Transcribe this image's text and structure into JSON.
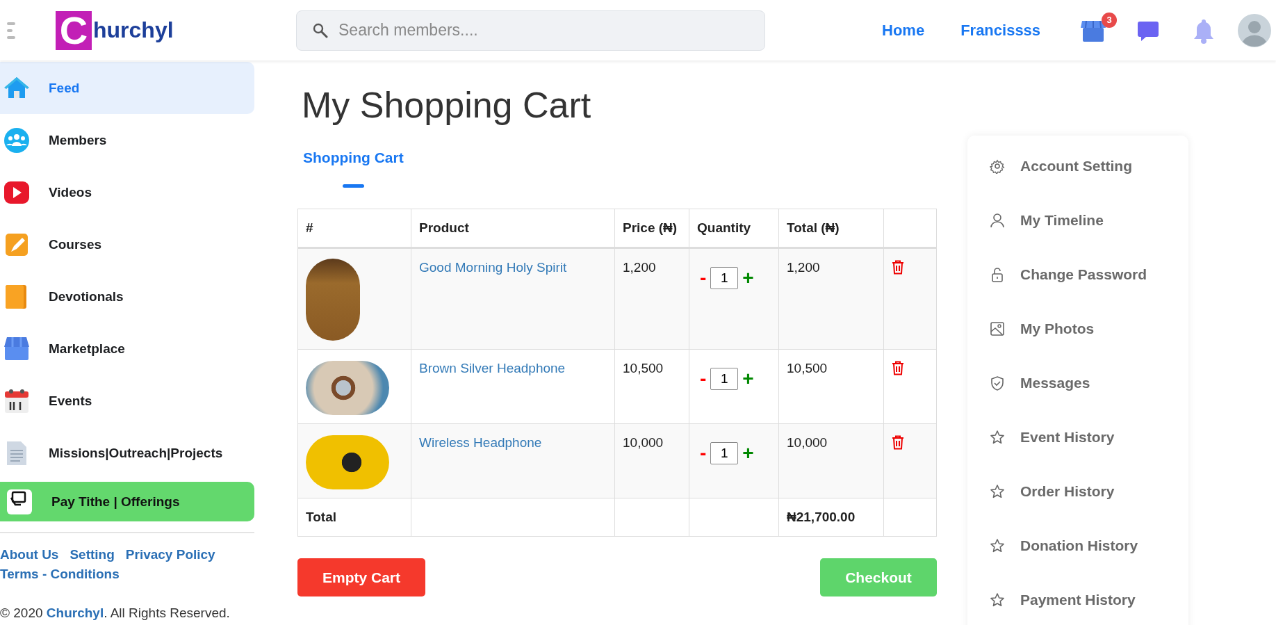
{
  "header": {
    "logo": {
      "mark_letter": "C",
      "text": "hurchyl"
    },
    "search": {
      "placeholder": "Search members...."
    },
    "nav_links": [
      "Home",
      "Francissss"
    ],
    "cart_badge": "3"
  },
  "sidebar": {
    "items": [
      {
        "label": "Feed",
        "selected": true,
        "kind": "link"
      },
      {
        "label": "Members",
        "selected": false,
        "kind": "link"
      },
      {
        "label": "Videos",
        "selected": false,
        "kind": "link"
      },
      {
        "label": "Courses",
        "selected": false,
        "kind": "link"
      },
      {
        "label": "Devotionals",
        "selected": false,
        "kind": "link"
      },
      {
        "label": "Marketplace",
        "selected": false,
        "kind": "link"
      },
      {
        "label": "Events",
        "selected": false,
        "kind": "link"
      },
      {
        "label": "Missions|Outreach|Projects",
        "selected": false,
        "kind": "link"
      },
      {
        "label": "Pay Tithe | Offerings",
        "selected": false,
        "kind": "pay"
      }
    ],
    "footer_links": [
      "About Us",
      "Setting",
      "Privacy Policy",
      "Terms - Conditions"
    ],
    "copyright": {
      "before": "© 2020 ",
      "link": "Churchyl",
      "after": ". All Rights Reserved."
    }
  },
  "main": {
    "title": "My Shopping Cart",
    "tabs": [
      {
        "label": "Shopping Cart",
        "selected": true
      }
    ],
    "table": {
      "columns": [
        "#",
        "Product",
        "Price (₦)",
        "Quantity",
        "Total (₦)"
      ],
      "rows": [
        {
          "product": "Good Morning Holy Spirit",
          "price": "1,200",
          "quantity": "1",
          "total": "1,200",
          "kind": "book"
        },
        {
          "product": "Brown Silver Headphone",
          "price": "10,500",
          "quantity": "1",
          "total": "10,500",
          "kind": "headphone"
        },
        {
          "product": "Wireless Headphone",
          "price": "10,000",
          "quantity": "1",
          "total": "10,000",
          "kind": "wireless"
        }
      ],
      "minus": "-",
      "plus": "+",
      "total_row": {
        "label": "Total",
        "value": "₦21,700.00"
      }
    },
    "buttons": {
      "empty": "Empty Cart",
      "checkout": "Checkout"
    }
  },
  "account_menu": {
    "items": [
      "Account Setting",
      "My Timeline",
      "Change Password",
      "My Photos",
      "Messages",
      "Event History",
      "Order History",
      "Donation History",
      "Payment History"
    ]
  }
}
